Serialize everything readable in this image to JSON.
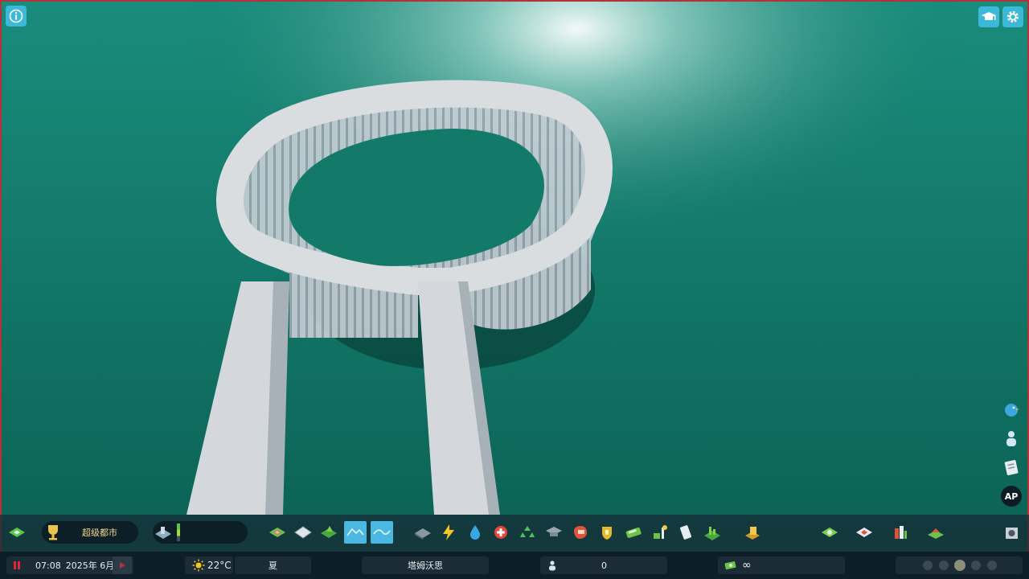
{
  "status": {
    "time": "07:08",
    "date": "2025年 6月",
    "temperature": "22°C",
    "season": "夏",
    "city_name": "塔姆沃思",
    "population": "0",
    "money": "∞"
  },
  "milestone": {
    "label": "超级都市"
  },
  "toolbar": {
    "icons": [
      "roads-icon",
      "zoning-icon",
      "areas-icon",
      "landscaping-icon",
      "terrain-icon",
      "water-tool-icon",
      "parks-icon",
      "electricity-icon",
      "water-icon",
      "health-icon",
      "recycling-icon",
      "education-icon",
      "police-icon",
      "fire-icon",
      "transport-icon",
      "industry-icon",
      "communication-icon",
      "signature-icon",
      "ring-road-icon",
      "map-tiles-icon",
      "statistics-icon",
      "city-services-icon",
      "photo-mode-icon"
    ]
  },
  "colors": {
    "water": "#0f7868",
    "panel": "#162a34",
    "accent": "#3cb8d8",
    "pause": "#e0283c",
    "milestone_text": "#f0d892"
  }
}
